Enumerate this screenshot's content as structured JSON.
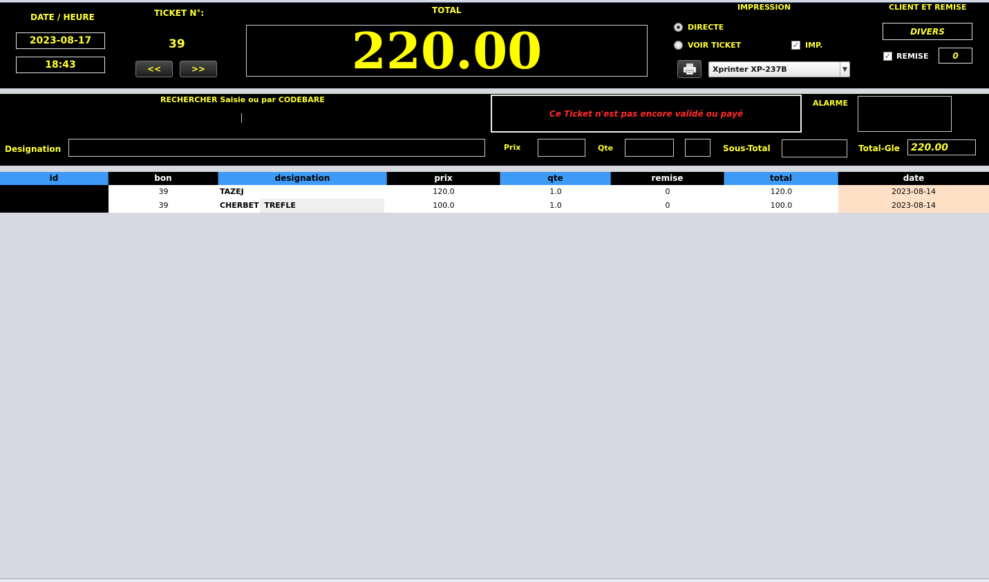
{
  "header": {
    "date_heure_label": "DATE / HEURE",
    "date": "2023-08-17",
    "time": "18:43",
    "ticket_label": "TICKET N°:",
    "ticket_number": "39",
    "prev_label": "<<",
    "next_label": ">>",
    "total_label": "TOTAL",
    "total_value": "220.00",
    "impression_label": "IMPRESSION",
    "radio_directe": "DIRECTE",
    "radio_voir_ticket": "VOIR TICKET",
    "imp_label": "IMP.",
    "printer_selected": "Xprinter XP-237B",
    "client_label": "CLIENT ET REMISE",
    "client_value": "DIVERS",
    "remise_label": "REMISE",
    "remise_value": "0"
  },
  "search": {
    "label": "RECHERCHER Saisie ou par CODEBARE",
    "status_message": "Ce Ticket n'est pas encore validé ou payé",
    "alarme_label": "ALARME",
    "designation_label": "Designation",
    "prix_label": "Prix",
    "qte_label": "Qte",
    "sous_total_label": "Sous-Total",
    "total_gle_label": "Total-Gle",
    "total_gle_value": "220.00"
  },
  "table": {
    "columns": [
      "id",
      "bon",
      "designation",
      "prix",
      "qte",
      "remise",
      "total",
      "date"
    ],
    "rows": [
      {
        "id": "",
        "bon": "39",
        "designation": "TAZEJ",
        "prix": "120.0",
        "qte": "1.0",
        "remise": "0",
        "total": "120.0",
        "date": "2023-08-14"
      },
      {
        "id": "",
        "bon": "39",
        "designation": "CHERBET  TREFLE",
        "prix": "100.0",
        "qte": "1.0",
        "remise": "0",
        "total": "100.0",
        "date": "2023-08-14"
      }
    ]
  },
  "colors": {
    "label_yellow": "#ffff33",
    "header_blue": "#3d9bf5",
    "status_red": "#ff2a2a",
    "date_cell": "#fde0c6"
  },
  "icons": {
    "printer": "printer-icon",
    "dropdown": "chevron-down-icon"
  }
}
